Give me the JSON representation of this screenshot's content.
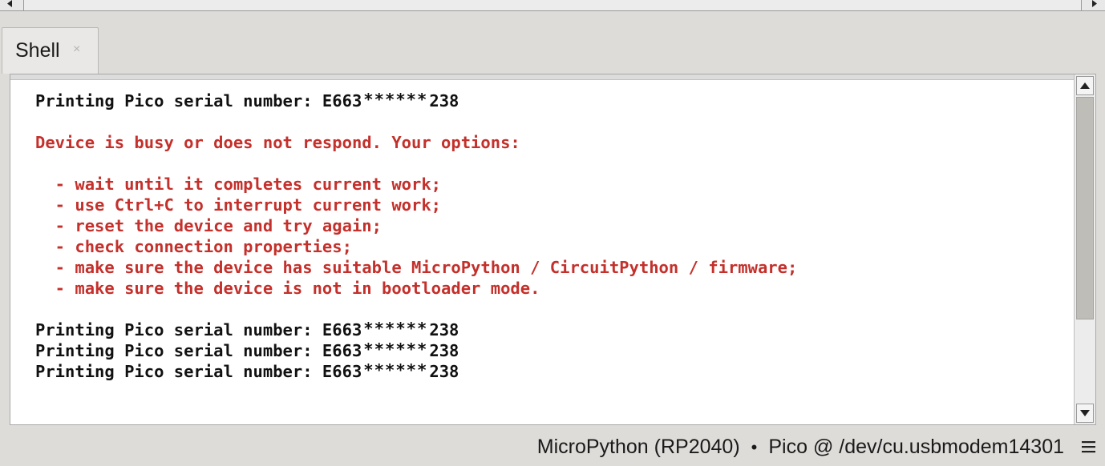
{
  "tab": {
    "label": "Shell",
    "close": "×"
  },
  "shell": {
    "lines": [
      {
        "kind": "normal",
        "prefix": "Printing Pico serial number: E663",
        "mask": "******",
        "suffix": "238"
      },
      {
        "kind": "blank",
        "text": ""
      },
      {
        "kind": "error",
        "text": "Device is busy or does not respond. Your options:"
      },
      {
        "kind": "blank",
        "text": ""
      },
      {
        "kind": "error",
        "text": "  - wait until it completes current work;"
      },
      {
        "kind": "error",
        "text": "  - use Ctrl+C to interrupt current work;"
      },
      {
        "kind": "error",
        "text": "  - reset the device and try again;"
      },
      {
        "kind": "error",
        "text": "  - check connection properties;"
      },
      {
        "kind": "error",
        "text": "  - make sure the device has suitable MicroPython / CircuitPython / firmware;"
      },
      {
        "kind": "error",
        "text": "  - make sure the device is not in bootloader mode."
      },
      {
        "kind": "blank",
        "text": ""
      },
      {
        "kind": "normal",
        "prefix": "Printing Pico serial number: E663",
        "mask": "******",
        "suffix": "238"
      },
      {
        "kind": "normal",
        "prefix": "Printing Pico serial number: E663",
        "mask": "******",
        "suffix": "238"
      },
      {
        "kind": "normal",
        "prefix": "Printing Pico serial number: E663",
        "mask": "******",
        "suffix": "238"
      }
    ]
  },
  "status": {
    "interpreter": "MicroPython (RP2040)",
    "separator": "•",
    "port": "Pico @ /dev/cu.usbmodem14301"
  },
  "colors": {
    "error": "#c4302b",
    "normal": "#111111",
    "scroll_thumb": "#bfbdb8"
  },
  "icons": {
    "scroll_left": "triangle-left-icon",
    "scroll_right": "triangle-right-icon",
    "scroll_up": "triangle-up-icon",
    "scroll_down": "triangle-down-icon",
    "menu": "hamburger-menu-icon"
  }
}
